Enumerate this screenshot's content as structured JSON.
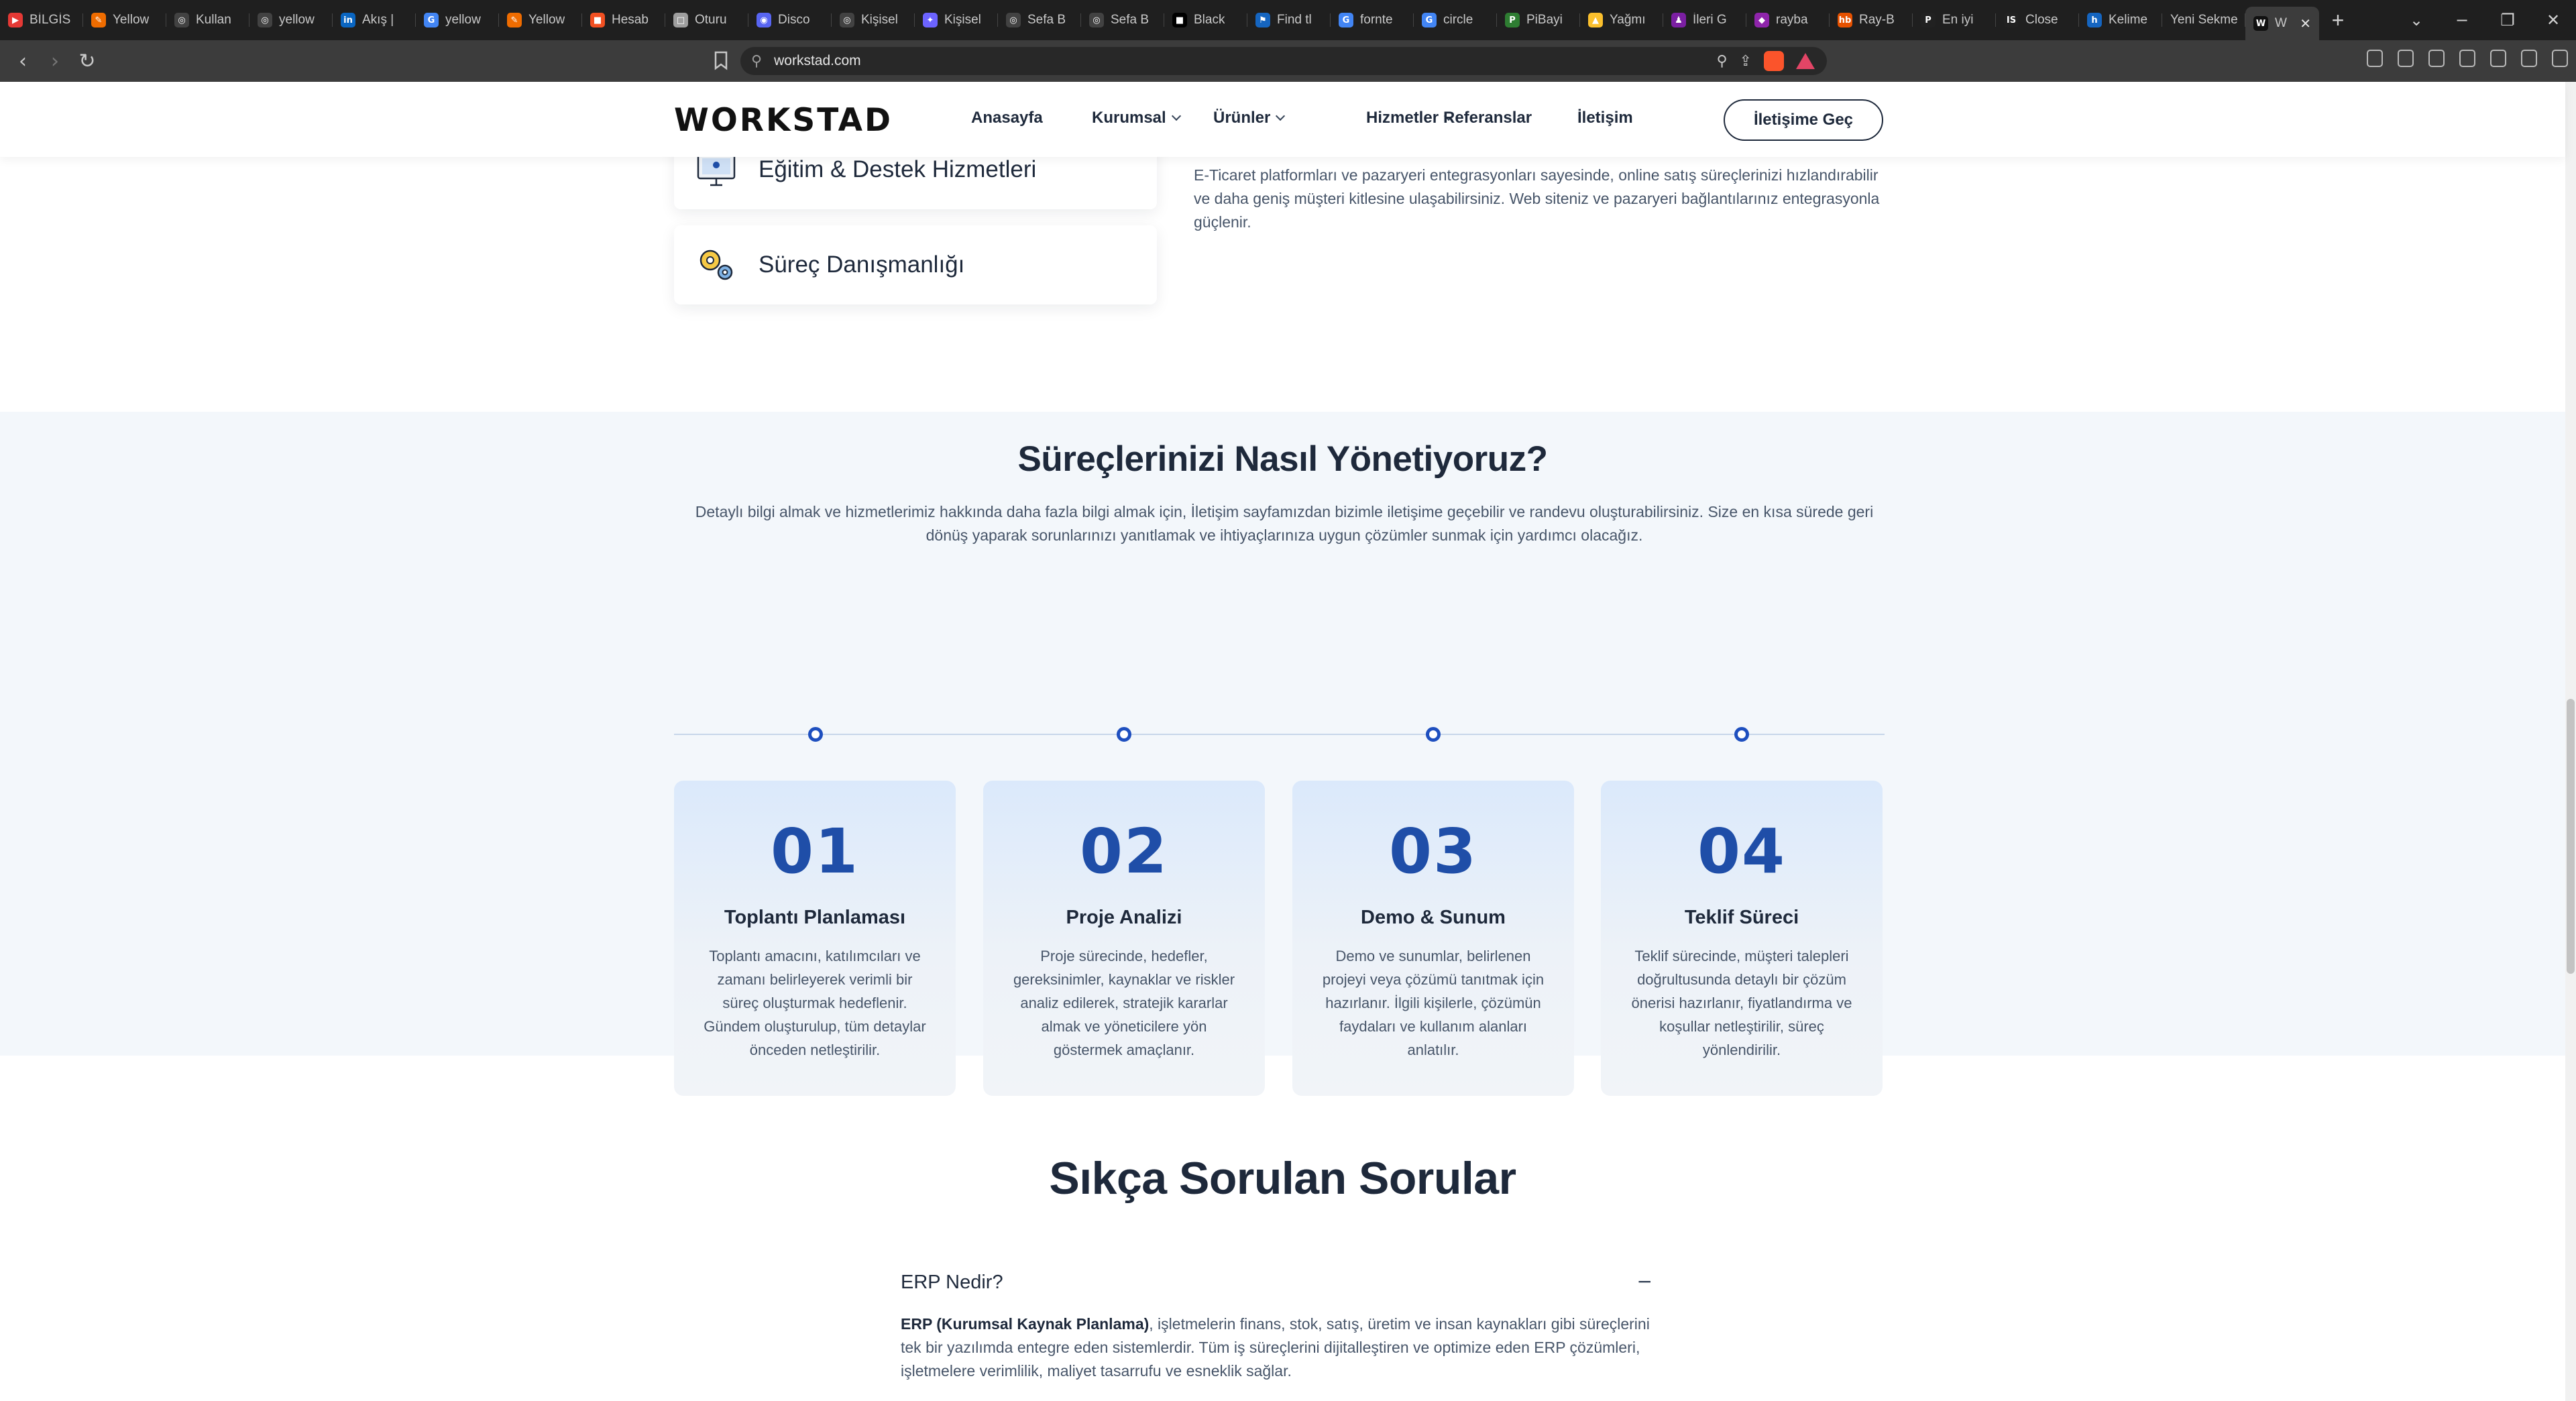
{
  "browser": {
    "tabs": [
      {
        "label": "BİLGİS",
        "color": "#e53935",
        "glyph": "▶"
      },
      {
        "label": "Yellow",
        "color": "#ef6c00",
        "glyph": "✎"
      },
      {
        "label": "Kullan",
        "color": "#424242",
        "glyph": "◎"
      },
      {
        "label": "yellow",
        "color": "#424242",
        "glyph": "◎"
      },
      {
        "label": "Akış |",
        "color": "#0a66c2",
        "glyph": "in"
      },
      {
        "label": "yellow",
        "color": "#4285f4",
        "glyph": "G"
      },
      {
        "label": "Yellow",
        "color": "#ef6c00",
        "glyph": "✎"
      },
      {
        "label": "Hesab",
        "color": "#f25022",
        "glyph": "■"
      },
      {
        "label": "Oturu",
        "color": "#9e9e9e",
        "glyph": "□"
      },
      {
        "label": "Disco",
        "color": "#5865f2",
        "glyph": "◉"
      },
      {
        "label": "Kişisel",
        "color": "#424242",
        "glyph": "◎"
      },
      {
        "label": "Kişisel",
        "color": "#6c63ff",
        "glyph": "✦"
      },
      {
        "label": "Sefa B",
        "color": "#424242",
        "glyph": "◎"
      },
      {
        "label": "Sefa B",
        "color": "#424242",
        "glyph": "◎"
      },
      {
        "label": "Black",
        "color": "#000000",
        "glyph": "■"
      },
      {
        "label": "Find tl",
        "color": "#1565c0",
        "glyph": "⚑"
      },
      {
        "label": "fornte",
        "color": "#4285f4",
        "glyph": "G"
      },
      {
        "label": "circle",
        "color": "#4285f4",
        "glyph": "G"
      },
      {
        "label": "PiBayi",
        "color": "#2e7d32",
        "glyph": "P"
      },
      {
        "label": "Yağmı",
        "color": "#fbc02d",
        "glyph": "▲"
      },
      {
        "label": "İleri G",
        "color": "#7b1fa2",
        "glyph": "♟"
      },
      {
        "label": "rayba",
        "color": "#8e24aa",
        "glyph": "◆"
      },
      {
        "label": "Ray-B",
        "color": "#e65100",
        "glyph": "hb"
      },
      {
        "label": "En iyi",
        "color": "#212121",
        "glyph": "P"
      },
      {
        "label": "Close",
        "color": "#212121",
        "glyph": "IS"
      },
      {
        "label": "Kelime",
        "color": "#1565c0",
        "glyph": "h"
      },
      {
        "label": "Yeni Sekme",
        "color": "",
        "glyph": ""
      }
    ],
    "active_tab": {
      "label": "W",
      "glyph": "W"
    },
    "url": "workstad.com"
  },
  "site": {
    "logo": "WORKSTAD",
    "menu": [
      {
        "label": "Anasayfa",
        "has_dropdown": false
      },
      {
        "label": "Kurumsal",
        "has_dropdown": true
      },
      {
        "label": "Ürünler",
        "has_dropdown": true
      },
      {
        "label": "Hizmetler",
        "has_dropdown": true
      },
      {
        "label": "Referanslar",
        "has_dropdown": false
      },
      {
        "label": "İletişim",
        "has_dropdown": false
      }
    ],
    "cta": "İletişime Geç"
  },
  "services": {
    "items": [
      {
        "label": "Eğitim & Destek Hizmetleri",
        "icon": "monitor-support-icon"
      },
      {
        "label": "Süreç Danışmanlığı",
        "icon": "gears-consulting-icon"
      }
    ],
    "description": "E-Ticaret platformları ve pazaryeri entegrasyonları sayesinde, online satış süreçlerinizi hızlandırabilir ve daha geniş müşteri kitlesine ulaşabilirsiniz. Web siteniz ve pazaryeri bağlantılarınız entegrasyonla güçlenir."
  },
  "process": {
    "title": "Süreçlerinizi Nasıl Yönetiyoruz?",
    "lead": "Detaylı bilgi almak ve hizmetlerimiz hakkında daha fazla bilgi almak için, İletişim sayfamızdan bizimle iletişime geçebilir ve randevu oluşturabilirsiniz. Size en kısa sürede geri dönüş yaparak sorunlarınızı yanıtlamak ve ihtiyaçlarınıza uygun çözümler sunmak için yardımcı olacağız.",
    "steps": [
      {
        "num": "01",
        "title": "Toplantı Planlaması",
        "text": "Toplantı amacını, katılımcıları ve zamanı belirleyerek verimli bir süreç oluşturmak hedeflenir. Gündem oluşturulup, tüm detaylar önceden netleştirilir."
      },
      {
        "num": "02",
        "title": "Proje Analizi",
        "text": "Proje sürecinde, hedefler, gereksinimler, kaynaklar ve riskler analiz edilerek, stratejik kararlar almak ve yöneticilere yön göstermek amaçlanır."
      },
      {
        "num": "03",
        "title": "Demo & Sunum",
        "text": "Demo ve sunumlar, belirlenen projeyi veya çözümü tanıtmak için hazırlanır. İlgili kişilerle, çözümün faydaları ve kullanım alanları anlatılır."
      },
      {
        "num": "04",
        "title": "Teklif Süreci",
        "text": "Teklif sürecinde, müşteri talepleri doğrultusunda detaylı bir çözüm önerisi hazırlanır, fiyatlandırma ve koşullar netleştirilir, süreç yönlendirilir."
      }
    ]
  },
  "faq": {
    "title": "Sıkça Sorulan Sorular",
    "items": [
      {
        "question": "ERP Nedir?",
        "toggle": "−",
        "answer_bold": "ERP (Kurumsal Kaynak Planlama)",
        "answer_rest": ", işletmelerin finans, stok, satış, üretim ve insan kaynakları gibi süreçlerini tek bir yazılımda entegre eden sistemlerdir. Tüm iş süreçlerini dijitalleştiren ve optimize eden ERP çözümleri, işletmelere verimlilik, maliyet tasarrufu ve esneklik sağlar."
      }
    ]
  },
  "colors": {
    "brand_blue": "#1f4ea8",
    "timeline_dot": "#1e4fbf",
    "section_bg": "#f3f7fb",
    "text_dark": "#1e293b",
    "text_muted": "#475569"
  }
}
